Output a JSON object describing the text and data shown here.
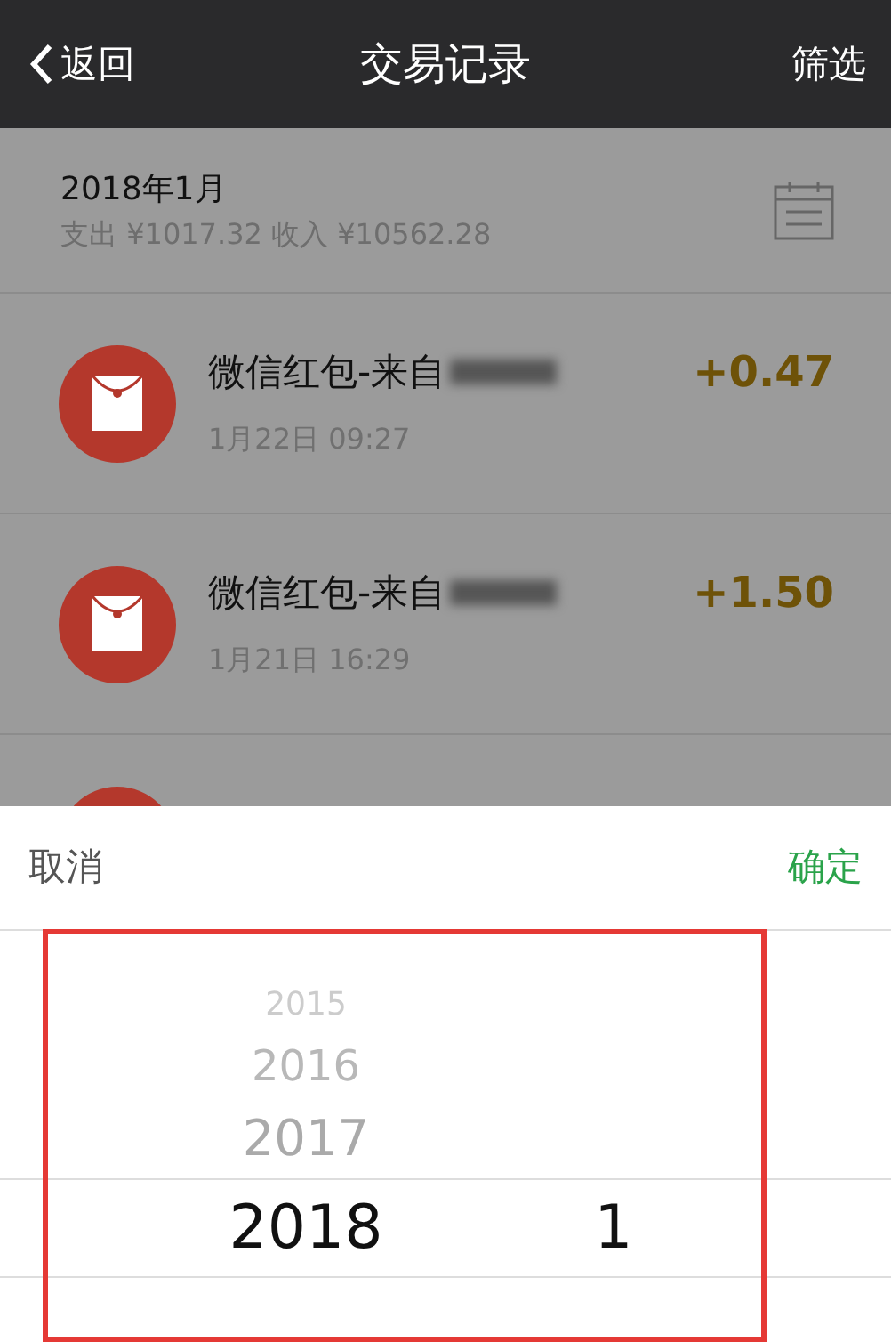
{
  "nav": {
    "back": "返回",
    "title": "交易记录",
    "filter": "筛选"
  },
  "month": {
    "label": "2018年1月",
    "summary": "支出 ¥1017.32 收入 ¥10562.28"
  },
  "transactions": [
    {
      "title": "微信红包-来自",
      "redacted": true,
      "time": "1月22日 09:27",
      "amount": "+0.47"
    },
    {
      "title": "微信红包-来自",
      "redacted": true,
      "time": "1月21日 16:29",
      "amount": "+1.50"
    }
  ],
  "sheet": {
    "cancel": "取消",
    "confirm": "确定"
  },
  "picker": {
    "columns": [
      {
        "items": [
          {
            "label": "2015",
            "selected": false
          },
          {
            "label": "2016",
            "selected": false
          },
          {
            "label": "2017",
            "selected": false
          },
          {
            "label": "2018",
            "selected": true
          }
        ]
      },
      {
        "items": [
          {
            "label": "1",
            "selected": true
          }
        ]
      }
    ]
  }
}
